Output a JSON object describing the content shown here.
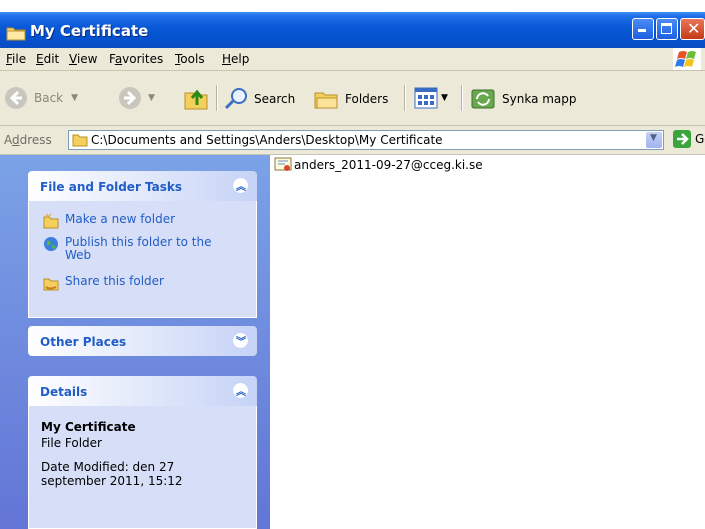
{
  "window": {
    "title": "My Certificate"
  },
  "menu": [
    {
      "label": "File",
      "underline": "F",
      "rest": "ile"
    },
    {
      "label": "Edit",
      "underline": "E",
      "rest": "dit"
    },
    {
      "label": "View",
      "underline": "V",
      "rest": "iew"
    },
    {
      "label": "Favorites",
      "pre": "F",
      "underline": "a",
      "rest": "vorites"
    },
    {
      "label": "Tools",
      "underline": "T",
      "rest": "ools"
    },
    {
      "label": "Help",
      "underline": "H",
      "rest": "elp"
    }
  ],
  "toolbar": {
    "back_label": "Back",
    "search_label": "Search",
    "folders_label": "Folders",
    "synka_label": "Synka mapp"
  },
  "address": {
    "label_pre": "A",
    "label_u": "d",
    "label_rest": "dress",
    "path": "C:\\Documents and Settings\\Anders\\Desktop\\My Certificate",
    "go_label": "Go"
  },
  "tasks_panel": {
    "title": "File and Folder Tasks",
    "items": [
      {
        "label": "Make a new folder",
        "icon": "new-folder-icon"
      },
      {
        "label": "Publish this folder to the Web",
        "icon": "publish-web-icon"
      },
      {
        "label": "Share this folder",
        "icon": "share-folder-icon"
      }
    ]
  },
  "other_places": {
    "title": "Other Places"
  },
  "details": {
    "title": "Details",
    "name": "My Certificate",
    "type": "File Folder",
    "modified": "Date Modified: den 27 september 2011, 15:12"
  },
  "files": [
    {
      "name": "anders_2011-09-27@cceg.ki.se",
      "icon": "certificate-file-icon"
    }
  ],
  "colors": {
    "titlebar": "#0a5ad8",
    "taskpane": "#7ba2e7",
    "panel_title": "#215dc6",
    "chrome": "#ece9d8"
  }
}
